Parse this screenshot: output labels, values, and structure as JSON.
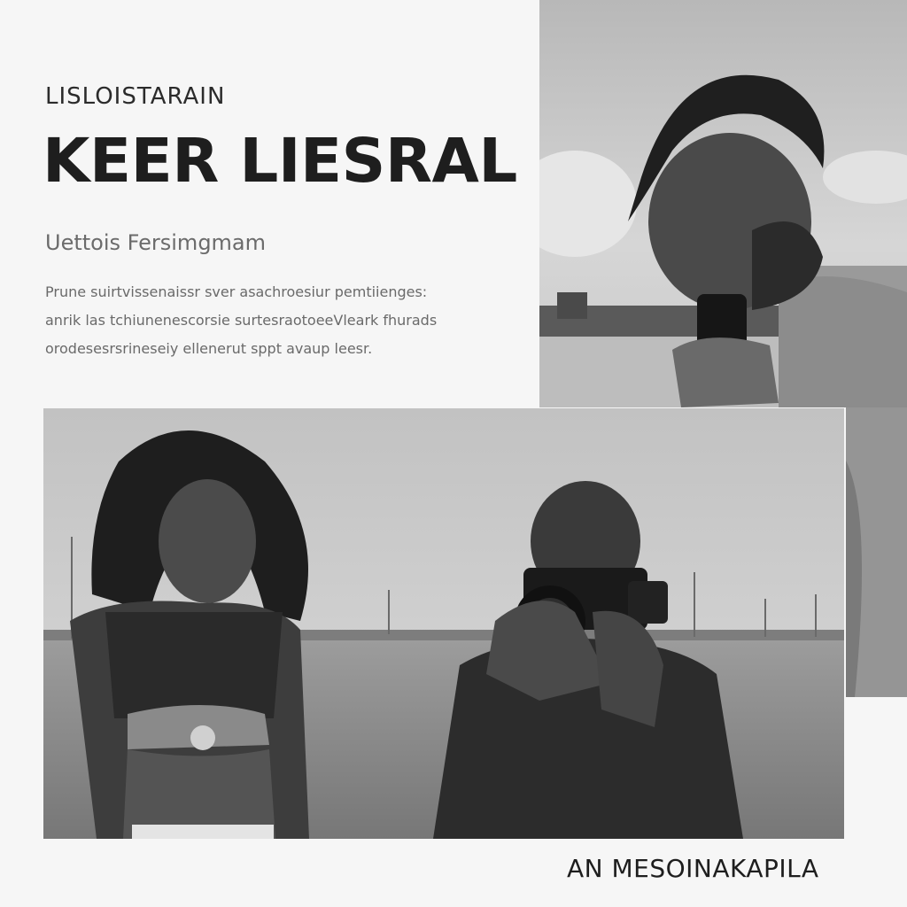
{
  "header": {
    "eyebrow": "LISLOISTARAIN",
    "headline": "KEER LIESRAL",
    "subhead": "Uettois Fersimgmam"
  },
  "body": {
    "lines": [
      "Prune suirtvissenaissr sver asachroesiur pemtiienges:",
      "anrik las tchiunenescorsie surtesraotoeeVleark fhurads",
      "orodesesrsrineseiy ellenerut sppt avaup leesr."
    ]
  },
  "footer": {
    "credit": "AN MESOINAKAPILA"
  }
}
